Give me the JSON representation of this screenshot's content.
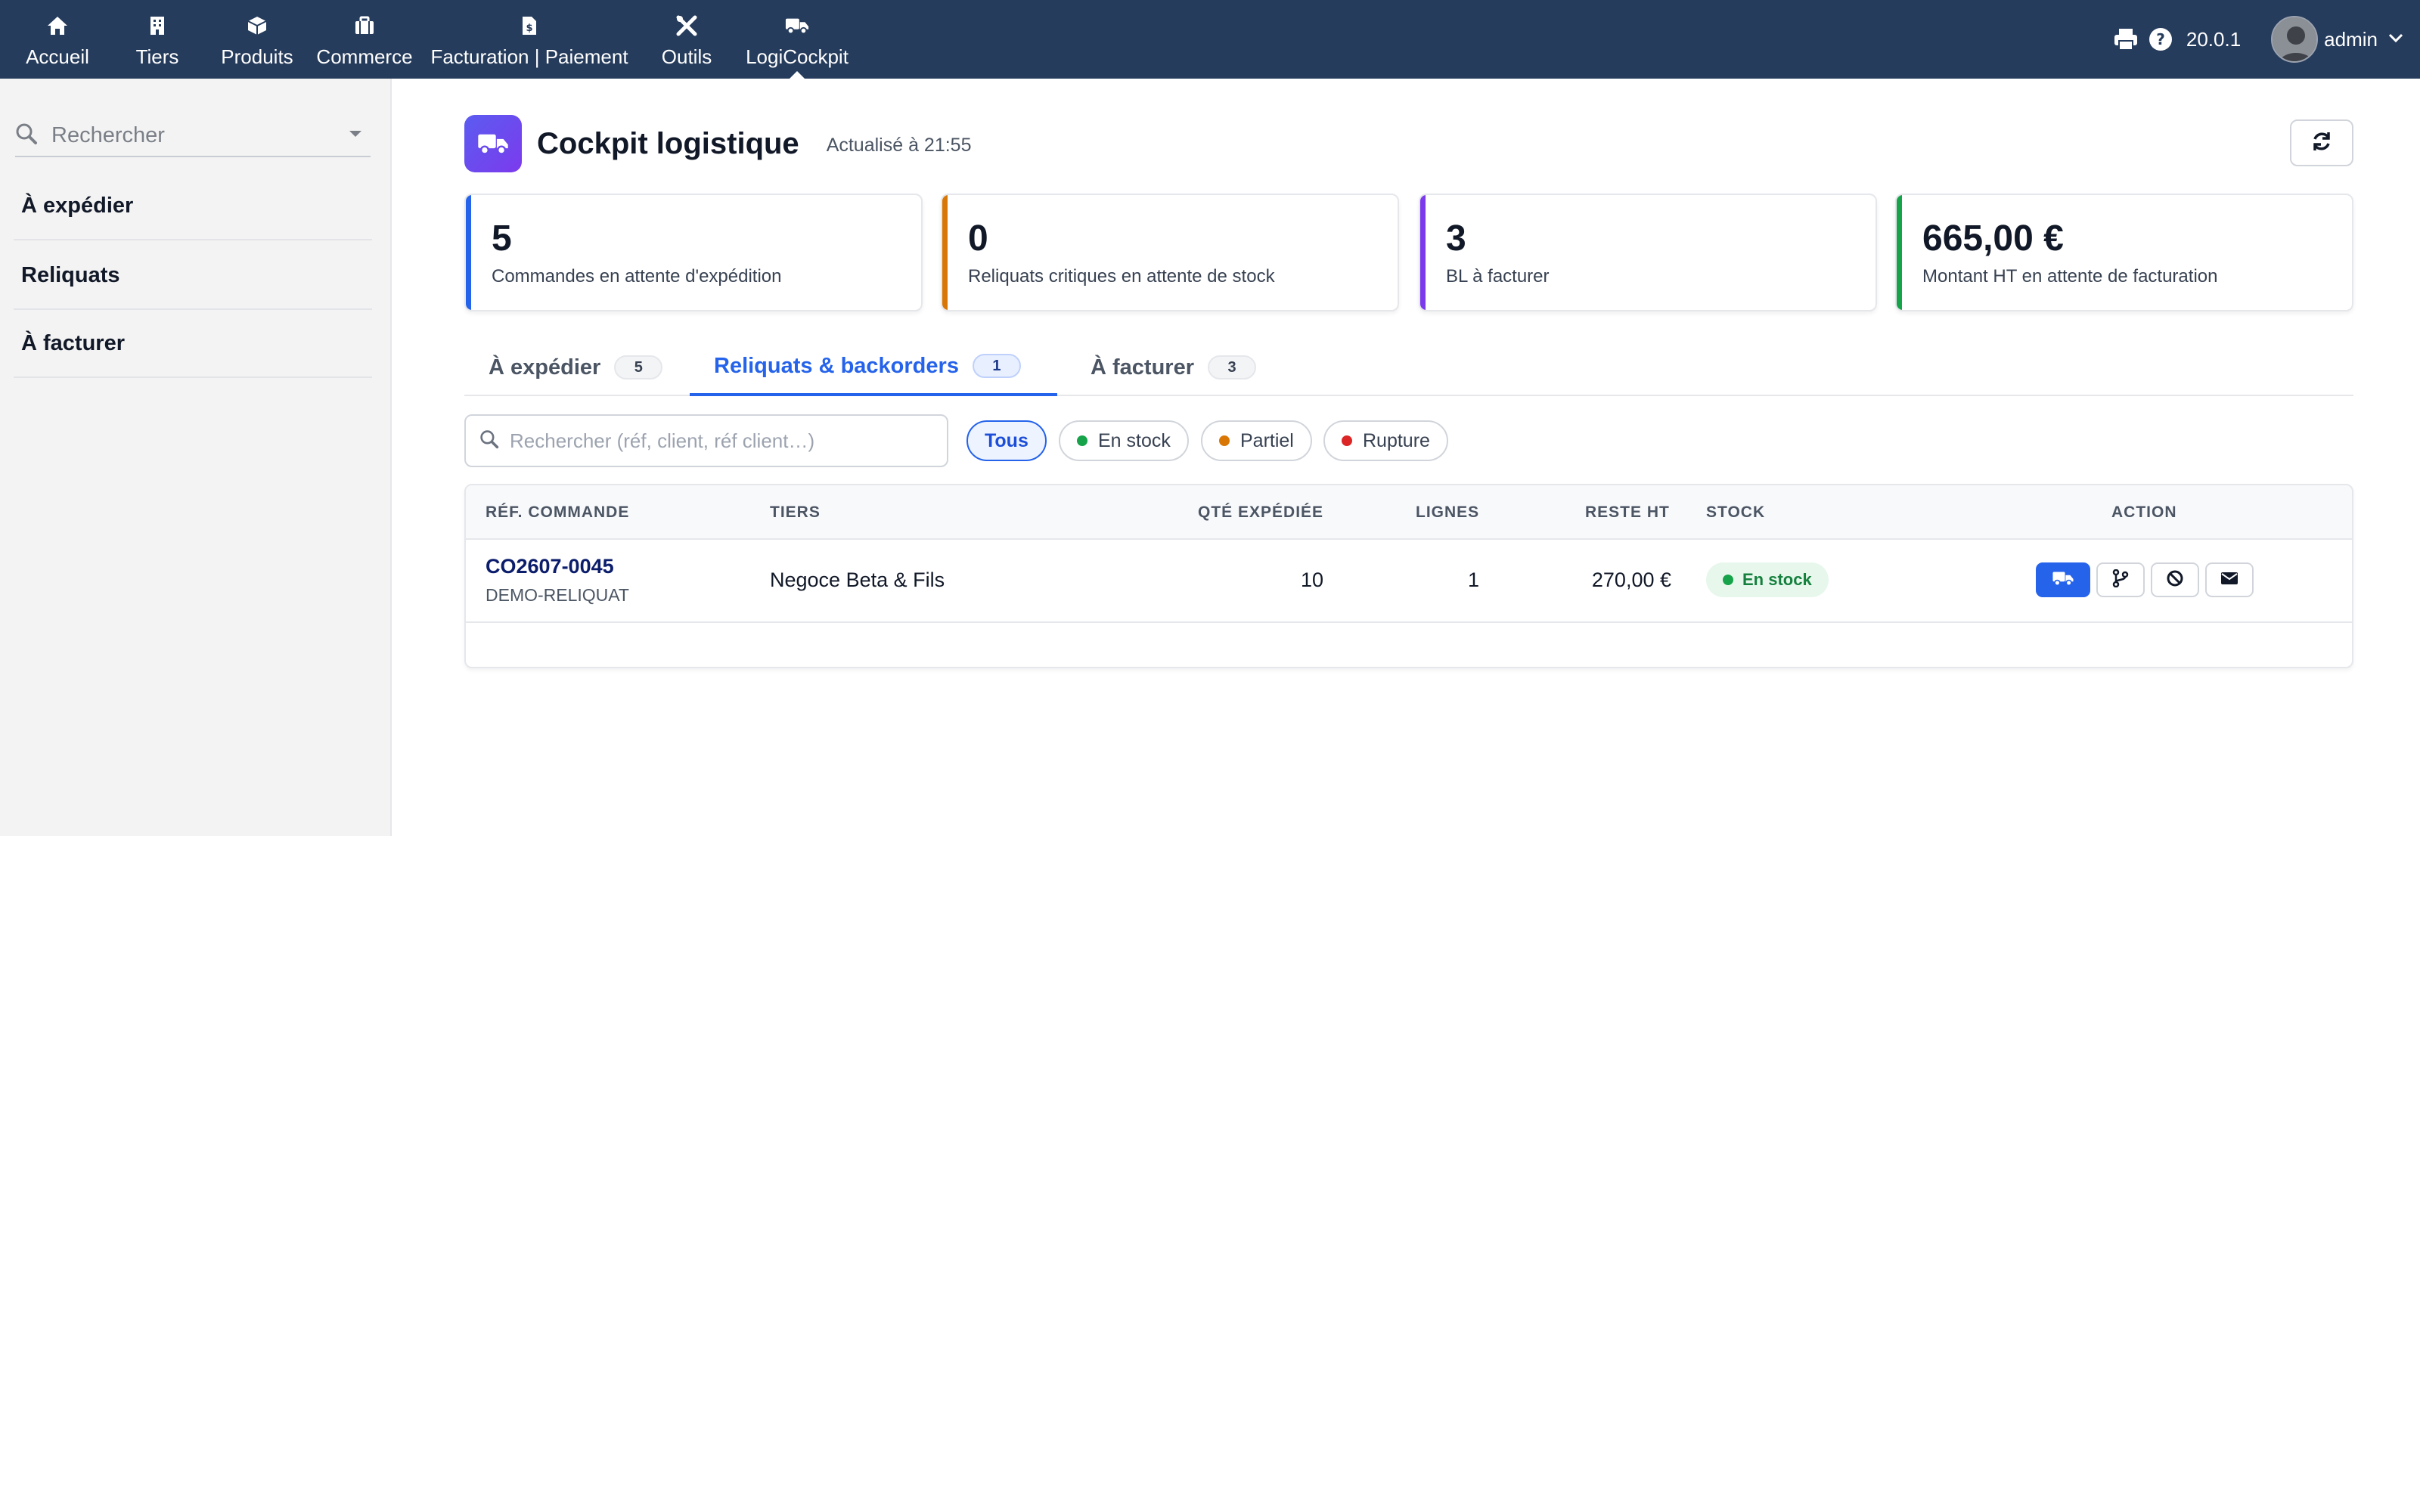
{
  "nav": {
    "items": [
      {
        "label": "Accueil",
        "icon": "home-icon"
      },
      {
        "label": "Tiers",
        "icon": "building-icon"
      },
      {
        "label": "Produits",
        "icon": "cube-icon"
      },
      {
        "label": "Commerce",
        "icon": "briefcase-icon"
      },
      {
        "label": "Facturation | Paiement",
        "icon": "invoice-icon"
      },
      {
        "label": "Outils",
        "icon": "tools-icon"
      },
      {
        "label": "LogiCockpit",
        "icon": "truck-icon"
      }
    ],
    "active": "LogiCockpit",
    "version": "20.0.1",
    "user": "admin"
  },
  "sidebar": {
    "search_placeholder": "Rechercher",
    "items": [
      {
        "label": "À expédier"
      },
      {
        "label": "Reliquats"
      },
      {
        "label": "À facturer"
      }
    ]
  },
  "header": {
    "title": "Cockpit logistique",
    "updated": "Actualisé à 21:55"
  },
  "kpis": [
    {
      "value": "5",
      "label": "Commandes en attente d'expédition",
      "color": "#2563eb"
    },
    {
      "value": "0",
      "label": "Reliquats critiques en attente de stock",
      "color": "#d97706"
    },
    {
      "value": "3",
      "label": "BL à facturer",
      "color": "#7c3aed"
    },
    {
      "value": "665,00 €",
      "label": "Montant HT en attente de facturation",
      "color": "#16a34a"
    }
  ],
  "tabs": [
    {
      "label": "À expédier",
      "count": "5"
    },
    {
      "label": "Reliquats & backorders",
      "count": "1"
    },
    {
      "label": "À facturer",
      "count": "3"
    }
  ],
  "active_tab": "Reliquats & backorders",
  "filters": {
    "search_placeholder": "Rechercher (réf, client, réf client…)",
    "chips": [
      {
        "label": "Tous",
        "dot": ""
      },
      {
        "label": "En stock",
        "dot": "#16a34a"
      },
      {
        "label": "Partiel",
        "dot": "#d97706"
      },
      {
        "label": "Rupture",
        "dot": "#dc2626"
      }
    ],
    "active_chip": "Tous"
  },
  "table": {
    "columns": [
      "RÉF. COMMANDE",
      "TIERS",
      "QTÉ EXPÉDIÉE",
      "LIGNES",
      "RESTE HT",
      "STOCK",
      "ACTION"
    ],
    "rows": [
      {
        "ref": "CO2607-0045",
        "ref_client": "DEMO-RELIQUAT",
        "tiers": "Negoce Beta & Fils",
        "qty_shipped": "10",
        "lines": "1",
        "remaining_ht": "270,00 €",
        "stock": "En stock"
      }
    ]
  },
  "colors": {
    "topbar": "#263c5c",
    "accent": "#2563eb",
    "stock_ok": "#16a34a"
  }
}
